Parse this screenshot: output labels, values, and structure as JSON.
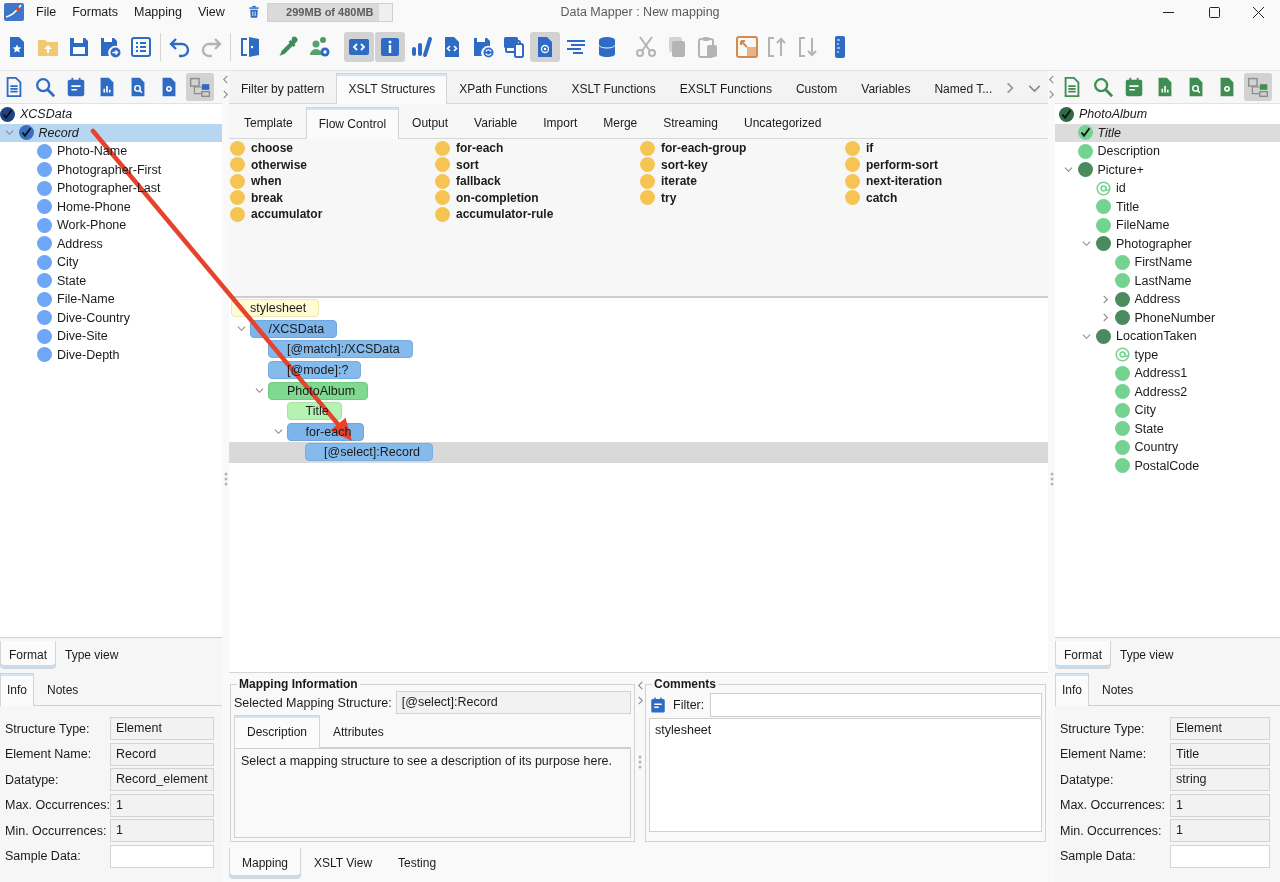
{
  "window": {
    "title": "Data Mapper : New mapping",
    "menu": [
      "File",
      "Formats",
      "Mapping",
      "View"
    ],
    "memory": {
      "text": "299MB of 480MB",
      "level": 0.9
    }
  },
  "toolbar": {
    "groups": [
      {
        "separator": true,
        "buttons": [
          {
            "selected": false,
            "disabled": false
          },
          {
            "selected": false,
            "disabled": false
          },
          {
            "selected": false,
            "disabled": false
          },
          {
            "selected": false,
            "disabled": false
          },
          {
            "selected": false,
            "disabled": false
          }
        ]
      },
      {
        "separator": true,
        "buttons": [
          {
            "selected": false,
            "disabled": false
          },
          {
            "selected": false,
            "disabled": true
          }
        ]
      },
      {
        "separator": false,
        "buttons": [
          {
            "selected": false,
            "disabled": false
          }
        ]
      },
      {
        "separator": false,
        "buttons": [
          {
            "selected": false,
            "disabled": false
          },
          {
            "selected": false,
            "disabled": false
          }
        ]
      },
      {
        "separator": false,
        "buttons": [
          {
            "selected": true,
            "disabled": false
          },
          {
            "selected": true,
            "disabled": false
          },
          {
            "selected": false,
            "disabled": false
          },
          {
            "selected": false,
            "disabled": false
          },
          {
            "selected": false,
            "disabled": false
          },
          {
            "selected": false,
            "disabled": false
          },
          {
            "selected": true,
            "disabled": false
          },
          {
            "selected": false,
            "disabled": false
          },
          {
            "selected": false,
            "disabled": false
          }
        ]
      },
      {
        "separator": false,
        "buttons": [
          {
            "selected": false,
            "disabled": true
          },
          {
            "selected": false,
            "disabled": true
          },
          {
            "selected": false,
            "disabled": true
          }
        ]
      },
      {
        "separator": false,
        "buttons": [
          {
            "selected": false,
            "disabled": false
          },
          {
            "selected": false,
            "disabled": true
          },
          {
            "selected": false,
            "disabled": true
          },
          {
            "selected": false,
            "disabled": false
          }
        ]
      }
    ]
  },
  "source_panel": {
    "focused": true,
    "tools": [
      {
        "selected": false
      },
      {
        "selected": false
      },
      {
        "selected": false
      },
      {
        "selected": false
      },
      {
        "selected": false
      },
      {
        "selected": false
      },
      {
        "selected": true
      }
    ],
    "tree": [
      {
        "label": "XCSData",
        "kind": "root",
        "checked": true,
        "selected": false,
        "children": [
          {
            "label": "Record",
            "kind": "group",
            "checked": true,
            "selected": true,
            "expanded": true,
            "children": [
              {
                "label": "Photo-Name",
                "kind": "element",
                "checked": false,
                "selected": false
              },
              {
                "label": "Photographer-First",
                "kind": "element",
                "checked": false,
                "selected": false
              },
              {
                "label": "Photographer-Last",
                "kind": "element",
                "checked": false,
                "selected": false
              },
              {
                "label": "Home-Phone",
                "kind": "element",
                "checked": false,
                "selected": false
              },
              {
                "label": "Work-Phone",
                "kind": "element",
                "checked": false,
                "selected": false
              },
              {
                "label": "Address",
                "kind": "element",
                "checked": false,
                "selected": false
              },
              {
                "label": "City",
                "kind": "element",
                "checked": false,
                "selected": false
              },
              {
                "label": "State",
                "kind": "element",
                "checked": false,
                "selected": false
              },
              {
                "label": "File-Name",
                "kind": "element",
                "checked": false,
                "selected": false
              },
              {
                "label": "Dive-Country",
                "kind": "element",
                "checked": false,
                "selected": false
              },
              {
                "label": "Dive-Site",
                "kind": "element",
                "checked": false,
                "selected": false
              },
              {
                "label": "Dive-Depth",
                "kind": "element",
                "checked": false,
                "selected": false
              }
            ]
          }
        ]
      }
    ],
    "view_tabs": [
      {
        "label": "Format",
        "selected": true
      },
      {
        "label": "Type view",
        "selected": false
      }
    ],
    "info_tabs": [
      {
        "label": "Info",
        "selected": true
      },
      {
        "label": "Notes",
        "selected": false
      }
    ],
    "fields": [
      {
        "label": "Structure Type:",
        "value": "Element",
        "readonly": true
      },
      {
        "label": "Element Name:",
        "value": "Record",
        "readonly": true
      },
      {
        "label": "Datatype:",
        "value": "Record_element",
        "readonly": true
      },
      {
        "label": "Max. Occurrences:",
        "value": "1",
        "readonly": true
      },
      {
        "label": "Min. Occurrences:",
        "value": "1",
        "readonly": true
      },
      {
        "label": "Sample Data:",
        "readonly": false
      }
    ]
  },
  "palette": {
    "categories": [
      {
        "label": "Filter by pattern",
        "selected": false
      },
      {
        "label": "XSLT Structures",
        "selected": true
      },
      {
        "label": "XPath Functions",
        "selected": false
      },
      {
        "label": "XSLT Functions",
        "selected": false
      },
      {
        "label": "EXSLT Functions",
        "selected": false
      },
      {
        "label": "Custom",
        "selected": false
      },
      {
        "label": "Variables",
        "selected": false
      },
      {
        "label": "Named T...",
        "selected": false
      }
    ],
    "subcategories": [
      {
        "label": "Template",
        "selected": false
      },
      {
        "label": "Flow Control",
        "selected": true
      },
      {
        "label": "Output",
        "selected": false
      },
      {
        "label": "Variable",
        "selected": false
      },
      {
        "label": "Import",
        "selected": false
      },
      {
        "label": "Merge",
        "selected": false
      },
      {
        "label": "Streaming",
        "selected": false
      },
      {
        "label": "Uncategorized",
        "selected": false
      }
    ],
    "items": [
      "choose",
      "for-each",
      "for-each-group",
      "if",
      "otherwise",
      "sort",
      "sort-key",
      "perform-sort",
      "when",
      "fallback",
      "iterate",
      "next-iteration",
      "break",
      "on-completion",
      "try",
      "catch",
      "accumulator",
      "accumulator-rule"
    ]
  },
  "mapping_tree": [
    {
      "label": "stylesheet",
      "kind": "stylesheet",
      "selected": false,
      "children": [
        {
          "label": "/XCSData",
          "kind": "instruction",
          "selected": false,
          "expanded": true,
          "children": [
            {
              "label": "[@match]:/XCSData",
              "kind": "attribute",
              "selected": false
            },
            {
              "label": "[@mode]:?",
              "kind": "attribute",
              "selected": false
            },
            {
              "label": "PhotoAlbum",
              "kind": "output_group",
              "selected": false,
              "expanded": true,
              "children": [
                {
                  "label": "Title",
                  "kind": "output_element",
                  "selected": false
                },
                {
                  "label": "for-each",
                  "kind": "instruction",
                  "selected": false,
                  "expanded": true,
                  "children": [
                    {
                      "label": "[@select]:Record",
                      "kind": "attribute",
                      "selected": true
                    }
                  ]
                }
              ]
            }
          ]
        }
      ]
    }
  ],
  "mapping_information": {
    "title": "Mapping Information",
    "selected_label": "Selected Mapping Structure:",
    "selected_value": "[@select]:Record",
    "tabs": [
      {
        "label": "Description",
        "selected": true
      },
      {
        "label": "Attributes",
        "selected": false
      }
    ],
    "description": "Select a mapping structure to see a description of its purpose here."
  },
  "comments": {
    "title": "Comments",
    "filter_label": "Filter:",
    "items": [
      "stylesheet"
    ]
  },
  "bottom_tabs": [
    {
      "label": "Mapping",
      "selected": true
    },
    {
      "label": "XSLT View",
      "selected": false
    },
    {
      "label": "Testing",
      "selected": false
    }
  ],
  "target_panel": {
    "focused": false,
    "tools": [
      {
        "selected": false
      },
      {
        "selected": false
      },
      {
        "selected": false
      },
      {
        "selected": false
      },
      {
        "selected": false
      },
      {
        "selected": false
      },
      {
        "selected": true
      }
    ],
    "tree": [
      {
        "label": "PhotoAlbum",
        "kind": "root",
        "checked": true,
        "selected": false,
        "children": [
          {
            "label": "Title",
            "kind": "element",
            "checked": true,
            "selected": true
          },
          {
            "label": "Description",
            "kind": "element",
            "checked": false,
            "selected": false
          },
          {
            "label": "Picture+",
            "kind": "group",
            "checked": false,
            "selected": false,
            "expanded": true,
            "children": [
              {
                "label": "id",
                "kind": "attribute",
                "checked": false,
                "selected": false
              },
              {
                "label": "Title",
                "kind": "element",
                "checked": false,
                "selected": false
              },
              {
                "label": "FileName",
                "kind": "element",
                "checked": false,
                "selected": false
              },
              {
                "label": "Photographer",
                "kind": "group",
                "checked": false,
                "selected": false,
                "expanded": true,
                "children": [
                  {
                    "label": "FirstName",
                    "kind": "element",
                    "checked": false,
                    "selected": false
                  },
                  {
                    "label": "LastName",
                    "kind": "element",
                    "checked": false,
                    "selected": false
                  },
                  {
                    "label": "Address",
                    "kind": "group",
                    "checked": false,
                    "selected": false,
                    "expanded": false
                  },
                  {
                    "label": "PhoneNumber",
                    "kind": "group",
                    "checked": false,
                    "selected": false,
                    "expanded": false
                  }
                ]
              },
              {
                "label": "LocationTaken",
                "kind": "group",
                "checked": false,
                "selected": false,
                "expanded": true,
                "children": [
                  {
                    "label": "type",
                    "kind": "attribute",
                    "checked": false,
                    "selected": false
                  },
                  {
                    "label": "Address1",
                    "kind": "element",
                    "checked": false,
                    "selected": false
                  },
                  {
                    "label": "Address2",
                    "kind": "element",
                    "checked": false,
                    "selected": false
                  },
                  {
                    "label": "City",
                    "kind": "element",
                    "checked": false,
                    "selected": false
                  },
                  {
                    "label": "State",
                    "kind": "element",
                    "checked": false,
                    "selected": false
                  },
                  {
                    "label": "Country",
                    "kind": "element",
                    "checked": false,
                    "selected": false
                  },
                  {
                    "label": "PostalCode",
                    "kind": "element",
                    "checked": false,
                    "selected": false
                  }
                ]
              }
            ]
          }
        ]
      }
    ],
    "view_tabs": [
      {
        "label": "Format",
        "selected": true
      },
      {
        "label": "Type view",
        "selected": false
      }
    ],
    "info_tabs": [
      {
        "label": "Info",
        "selected": true
      },
      {
        "label": "Notes",
        "selected": false
      }
    ],
    "fields": [
      {
        "label": "Structure Type:",
        "value": "Element",
        "readonly": true
      },
      {
        "label": "Element Name:",
        "value": "Title",
        "readonly": true
      },
      {
        "label": "Datatype:",
        "value": "string",
        "readonly": true
      },
      {
        "label": "Max. Occurrences:",
        "value": "1",
        "readonly": true
      },
      {
        "label": "Min. Occurrences:",
        "value": "1",
        "readonly": true
      },
      {
        "label": "Sample Data:",
        "readonly": false
      }
    ]
  }
}
